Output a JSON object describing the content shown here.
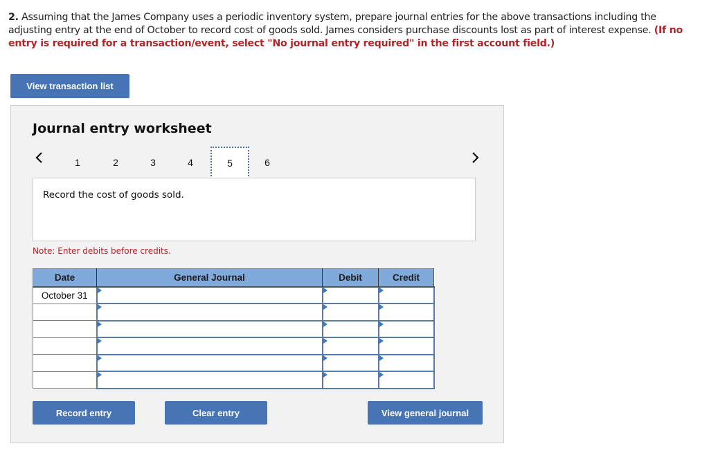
{
  "question": {
    "number": "2.",
    "text": " Assuming that the James Company uses a periodic inventory system, prepare journal entries for the above transactions including the adjusting entry at the end of October to record cost of goods sold. James considers purchase discounts lost as part of interest expense. ",
    "instruction": "(If no entry is required for a transaction/event, select \"No journal entry required\" in the first account field.)"
  },
  "buttons": {
    "view_transaction_list": "View transaction list",
    "record_entry": "Record entry",
    "clear_entry": "Clear entry",
    "view_general_journal": "View general journal"
  },
  "worksheet": {
    "title": "Journal entry worksheet",
    "prev_icon": "chevron-left-icon",
    "next_icon": "chevron-right-icon",
    "tabs": [
      "1",
      "2",
      "3",
      "4",
      "5",
      "6"
    ],
    "active_tab": "5",
    "description": "Record the cost of goods sold.",
    "note": "Note: Enter debits before credits."
  },
  "journal": {
    "headers": {
      "date": "Date",
      "general_journal": "General Journal",
      "debit": "Debit",
      "credit": "Credit"
    },
    "rows": [
      {
        "date": "October 31",
        "account": "",
        "debit": "",
        "credit": ""
      },
      {
        "date": "",
        "account": "",
        "debit": "",
        "credit": ""
      },
      {
        "date": "",
        "account": "",
        "debit": "",
        "credit": ""
      },
      {
        "date": "",
        "account": "",
        "debit": "",
        "credit": ""
      },
      {
        "date": "",
        "account": "",
        "debit": "",
        "credit": ""
      },
      {
        "date": "",
        "account": "",
        "debit": "",
        "credit": ""
      }
    ]
  },
  "colors": {
    "button_blue": "#4674b4",
    "header_blue": "#80a9dc",
    "instruction_red": "#b0242a",
    "panel_gray": "#f2f2f2"
  }
}
